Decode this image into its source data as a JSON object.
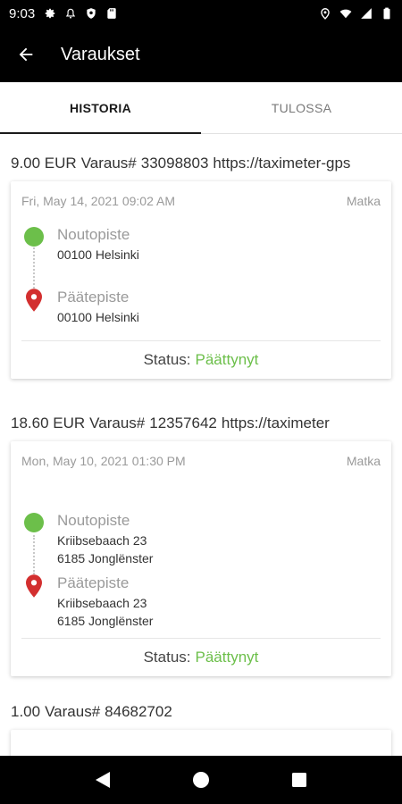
{
  "status_bar": {
    "time": "9:03"
  },
  "app_bar": {
    "title": "Varaukset"
  },
  "tabs": [
    {
      "label": "HISTORIA",
      "active": true
    },
    {
      "label": "TULOSSA",
      "active": false
    }
  ],
  "bookings": [
    {
      "price": "9.00 EUR",
      "booking_label": "Varaus#",
      "booking_number": "33098803",
      "link": "https://taximeter-gps",
      "date": "Fri, May 14, 2021 09:02 AM",
      "type": "Matka",
      "pickup_label": "Noutopiste",
      "pickup_address": [
        "00100 Helsinki"
      ],
      "dropoff_label": "Päätepiste",
      "dropoff_address": [
        "00100 Helsinki"
      ],
      "status_label": "Status:",
      "status_value": "Päättynyt"
    },
    {
      "price": "18.60 EUR",
      "booking_label": "Varaus#",
      "booking_number": "12357642",
      "link": "https://taximeter",
      "date": "Mon, May 10, 2021 01:30 PM",
      "type": "Matka",
      "pickup_label": "Noutopiste",
      "pickup_address": [
        "Kriibsebaach 23",
        "6185 Jonglënster"
      ],
      "dropoff_label": "Päätepiste",
      "dropoff_address": [
        "Kriibsebaach 23",
        "6185 Jonglënster"
      ],
      "status_label": "Status:",
      "status_value": "Päättynyt"
    },
    {
      "price": "1.00",
      "booking_label": "Varaus#",
      "booking_number": "84682702"
    }
  ],
  "colors": {
    "accent_green": "#6cbf4a",
    "pin_red": "#d32f2f"
  }
}
